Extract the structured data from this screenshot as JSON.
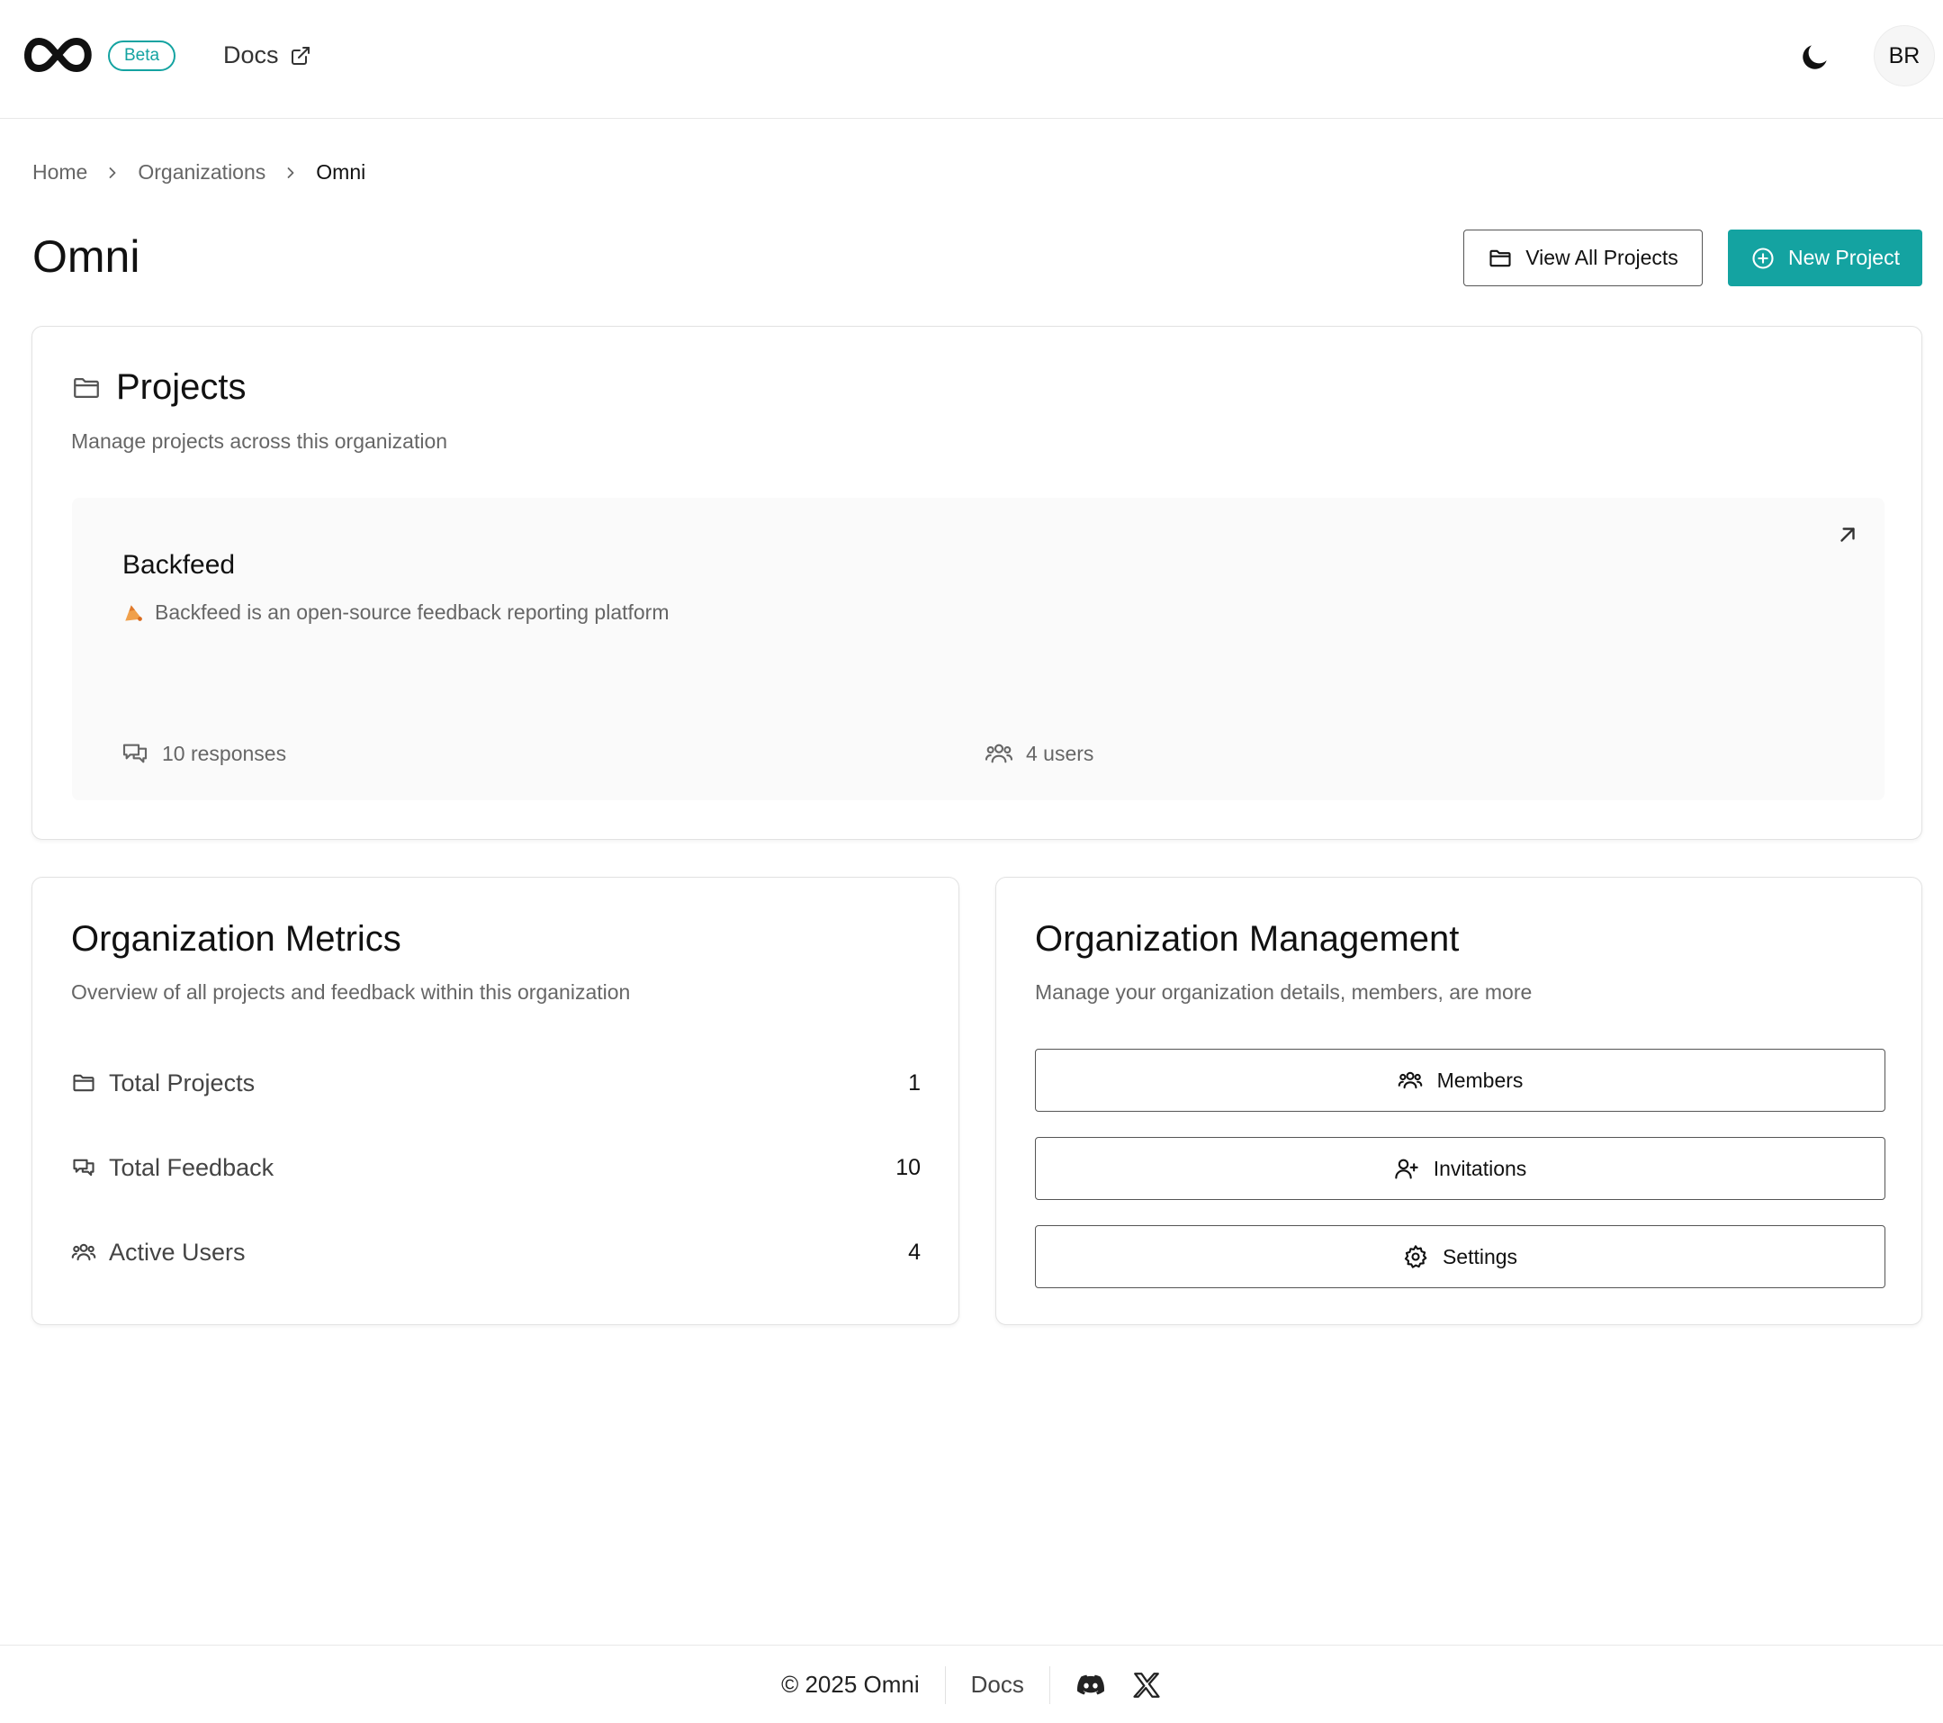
{
  "header": {
    "badge": "Beta",
    "docs_label": "Docs",
    "avatar_initials": "BR"
  },
  "breadcrumb": [
    {
      "label": "Home"
    },
    {
      "label": "Organizations"
    },
    {
      "label": "Omni"
    }
  ],
  "page": {
    "title": "Omni",
    "view_all_label": "View All Projects",
    "new_project_label": "New Project"
  },
  "projects": {
    "title": "Projects",
    "subtitle": "Manage projects across this organization",
    "items": [
      {
        "name": "Backfeed",
        "description": "Backfeed is an open-source feedback reporting platform",
        "responses": "10 responses",
        "users": "4 users"
      }
    ]
  },
  "metrics": {
    "title": "Organization Metrics",
    "subtitle": "Overview of all projects and feedback within this organization",
    "rows": [
      {
        "label": "Total Projects",
        "value": "1"
      },
      {
        "label": "Total Feedback",
        "value": "10"
      },
      {
        "label": "Active Users",
        "value": "4"
      }
    ]
  },
  "management": {
    "title": "Organization Management",
    "subtitle": "Manage your organization details, members, are more",
    "buttons": [
      {
        "label": "Members"
      },
      {
        "label": "Invitations"
      },
      {
        "label": "Settings"
      }
    ]
  },
  "footer": {
    "copyright": "© 2025 Omni",
    "docs_label": "Docs"
  },
  "colors": {
    "accent": "#14a3a1",
    "text": "#111111",
    "muted": "#666666",
    "border": "#e2e2e2"
  },
  "icons": {
    "logo": "infinity-icon",
    "external": "external-link-icon",
    "theme": "moon-icon",
    "folder": "folder-icon",
    "plus": "plus-circle-icon",
    "arrow": "arrow-up-right-icon",
    "chat": "messages-icon",
    "users": "users-icon",
    "user_plus": "user-plus-icon",
    "gear": "gear-icon",
    "discord": "discord-icon",
    "x": "x-logo-icon"
  }
}
